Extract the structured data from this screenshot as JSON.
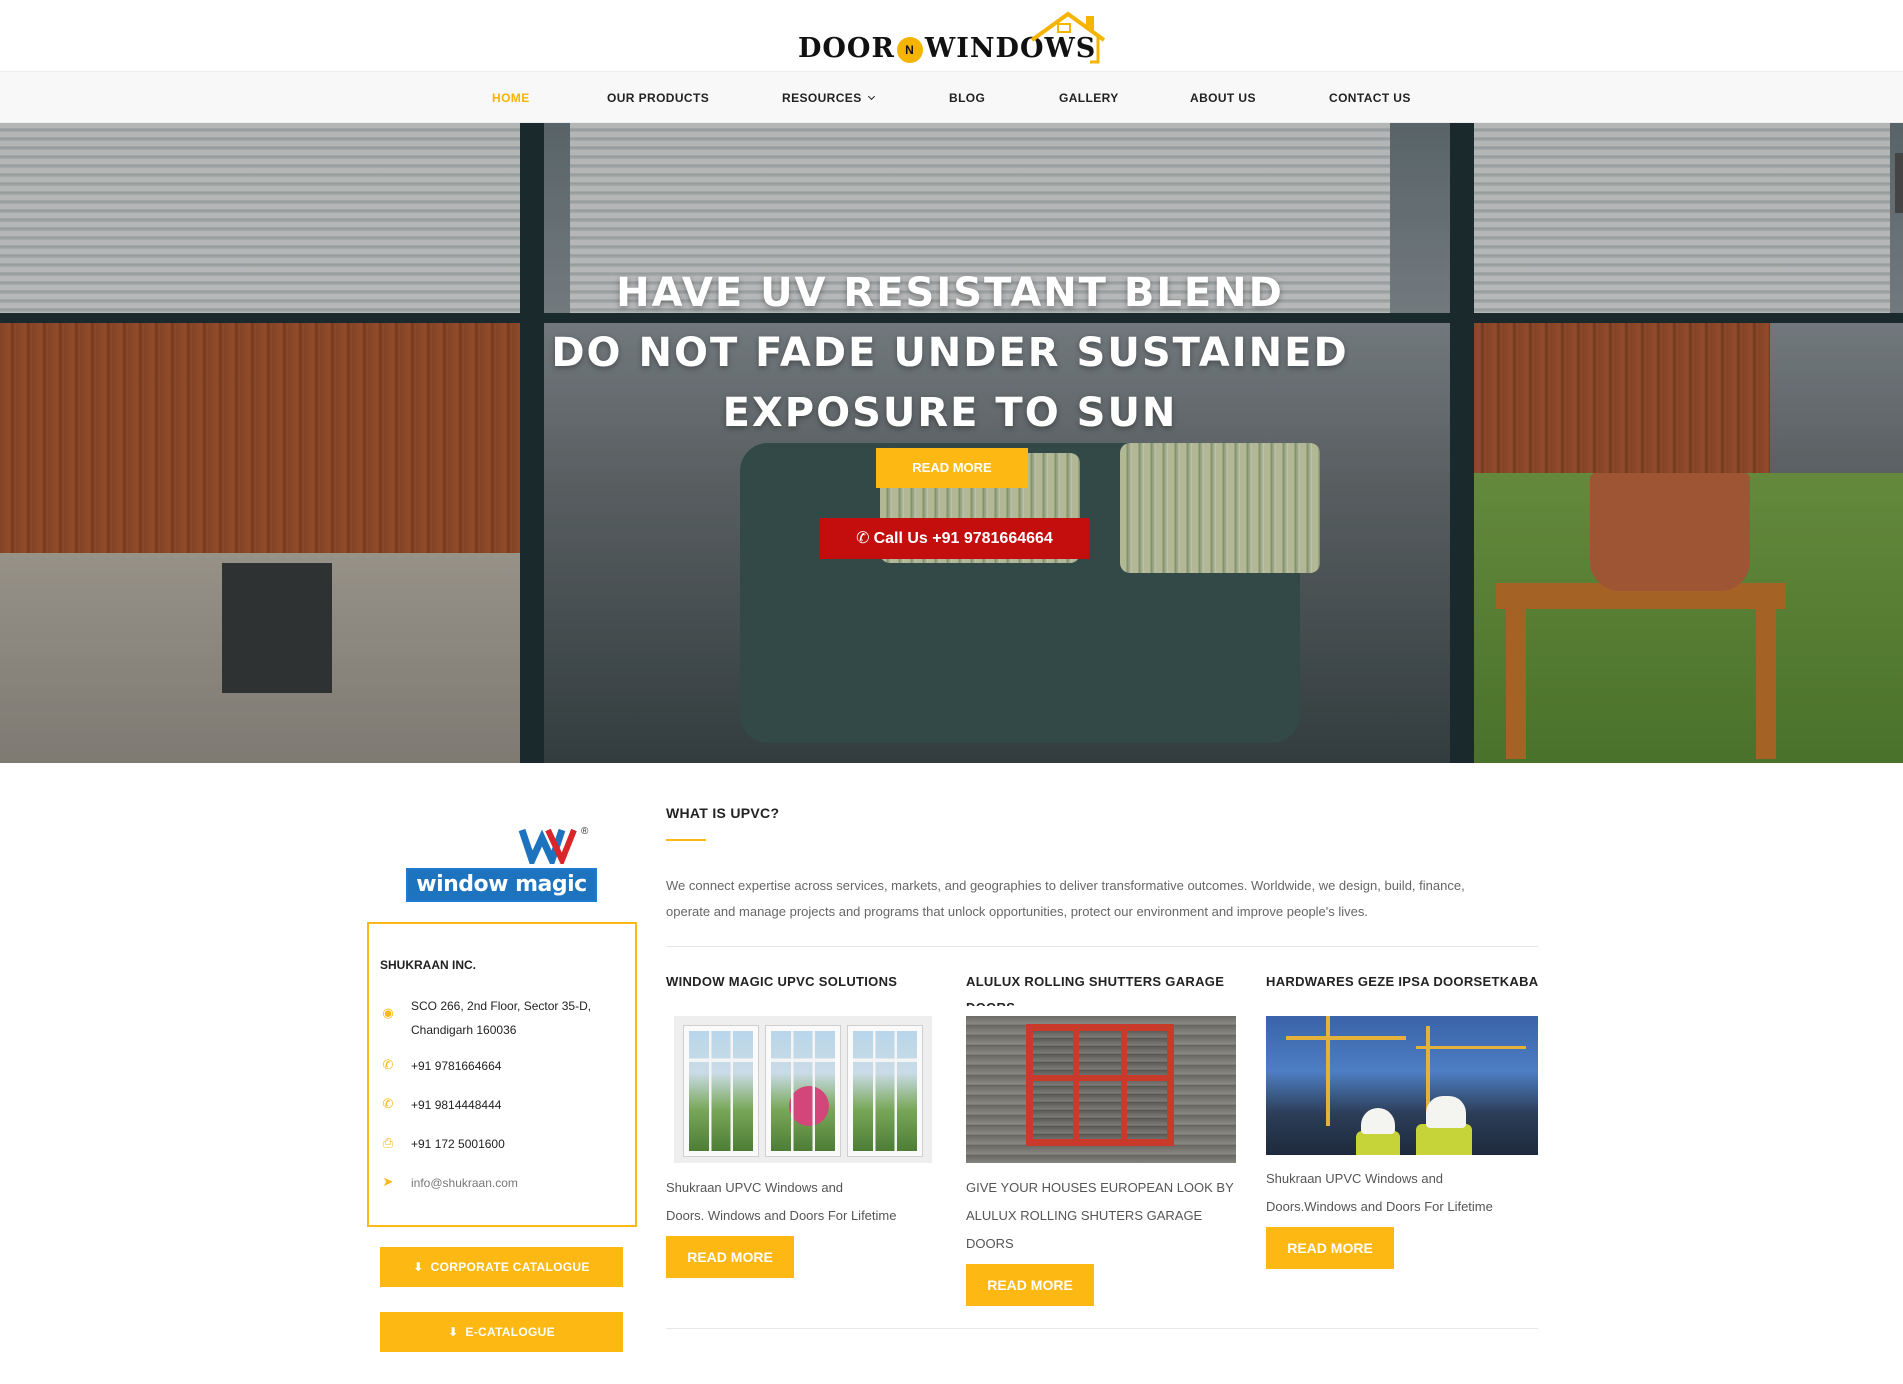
{
  "site": {
    "logo_left": "DOOR",
    "logo_mid": "N",
    "logo_right": "WINDOWS"
  },
  "nav": {
    "items": [
      {
        "label": "HOME",
        "active": true
      },
      {
        "label": "OUR PRODUCTS"
      },
      {
        "label": "RESOURCES"
      },
      {
        "label": "BLOG"
      },
      {
        "label": "GALLERY"
      },
      {
        "label": "ABOUT US"
      },
      {
        "label": "CONTACT US"
      }
    ]
  },
  "hero": {
    "line1": "HAVE UV RESISTANT BLEND",
    "line2": "DO NOT FADE UNDER SUSTAINED",
    "line3": "EXPOSURE TO SUN",
    "read_more": "READ MORE",
    "call": "Call Us +91 9781664664"
  },
  "sidebar": {
    "brand_mark": "WM",
    "brand_word": "window magic",
    "brand_reg": "®",
    "company": "SHUKRAAN INC.",
    "address_1": "SCO 266, 2nd Floor, Sector 35-D,",
    "address_2": "Chandigarh 160036",
    "phone_1": "+91 9781664664",
    "phone_2": "+91 9814448444",
    "fax": "+91 172 5001600",
    "email": "info@shukraan.com",
    "corporate_catalogue": "CORPORATE CATALOGUE",
    "e_catalogue": "E-CATALOGUE"
  },
  "main": {
    "title": "WHAT IS UPVC?",
    "desc_1": "We connect expertise across services, markets, and geographies to deliver transformative outcomes. Worldwide, we design, build, finance,",
    "desc_2": "operate and manage projects and programs that unlock opportunities, protect our environment and improve people's lives."
  },
  "cards": [
    {
      "title": "WINDOW MAGIC UPVC SOLUTIONS",
      "text_1": "Shukraan UPVC Windows and",
      "text_2": "Doors. Windows and Doors For Lifetime",
      "button": "READ MORE"
    },
    {
      "title": "ALULUX ROLLING SHUTTERS GARAGE",
      "title_overflow": "DOORS",
      "text_1": "GIVE YOUR HOUSES EUROPEAN LOOK BY",
      "text_2": "ALULUX ROLLING SHUTERS GARAGE",
      "text_3": "DOORS",
      "button": "READ MORE"
    },
    {
      "title": "HARDWARES GEZE IPSA DOORSETKABA",
      "text_1": "Shukraan UPVC Windows and",
      "text_2": "Doors.Windows and Doors For Lifetime",
      "button": "READ MORE"
    }
  ],
  "colors": {
    "accent": "#fdb813",
    "call_red": "#c40d0d",
    "brand_blue": "#1e73be"
  }
}
